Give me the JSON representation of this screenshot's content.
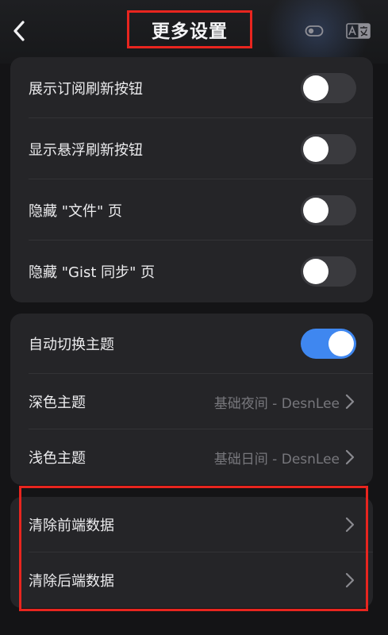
{
  "header": {
    "title": "更多设置",
    "back_icon": "chevron-left-icon",
    "theme_toggle_icon": "toggle-icon",
    "translate_icon": "translate-icon"
  },
  "group1": {
    "items": [
      {
        "label": "展示订阅刷新按钮",
        "on": false
      },
      {
        "label": "显示悬浮刷新按钮",
        "on": false
      },
      {
        "label": "隐藏 \"文件\" 页",
        "on": false
      },
      {
        "label": "隐藏 \"Gist 同步\" 页",
        "on": false
      }
    ]
  },
  "group2": {
    "auto_theme": {
      "label": "自动切换主题",
      "on": true
    },
    "dark_theme": {
      "label": "深色主题",
      "value": "基础夜间 - DesnLee"
    },
    "light_theme": {
      "label": "浅色主题",
      "value": "基础日间 - DesnLee"
    }
  },
  "group3": {
    "clear_frontend": "清除前端数据",
    "clear_backend": "清除后端数据"
  },
  "colors": {
    "accent": "#3f87f0",
    "highlight": "#e8251f",
    "background": "#141416",
    "card": "#252528"
  }
}
